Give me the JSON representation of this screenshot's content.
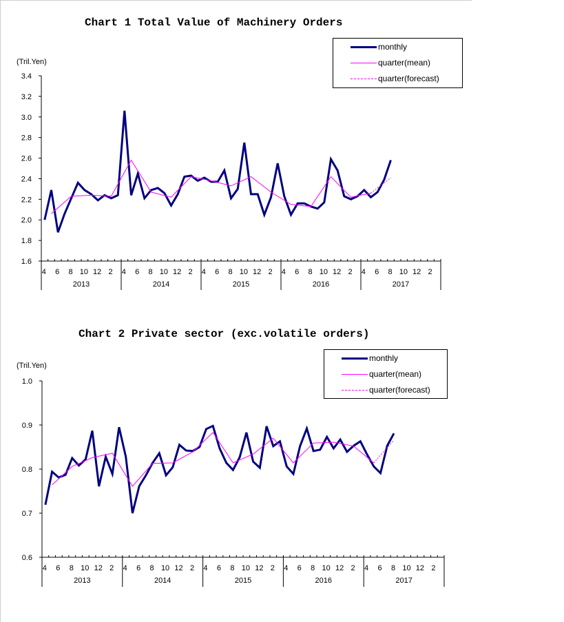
{
  "page": {
    "frame": "light-gray border top/left"
  },
  "colors": {
    "monthly": "#000080",
    "quarter_mean": "#ff00ff",
    "quarter_forecast": "#ff00ff",
    "axis": "#000000"
  },
  "legend_labels": {
    "monthly": "monthly",
    "quarter_mean": "quarter(mean)",
    "quarter_forecast": "quarter(forecast)"
  },
  "chart_data": [
    {
      "type": "line",
      "title": "Chart 1 Total Value of Machinery Orders",
      "ylabel": "(Tril.Yen)",
      "xlabel": "",
      "ylim": [
        1.6,
        3.4
      ],
      "yticks": [
        "1.6",
        "1.8",
        "2.0",
        "2.2",
        "2.4",
        "2.6",
        "2.8",
        "3.0",
        "3.2",
        "3.4"
      ],
      "ytick_values": [
        1.6,
        1.8,
        2.0,
        2.2,
        2.4,
        2.6,
        2.8,
        3.0,
        3.2,
        3.4
      ],
      "x_months": 60,
      "x_month_labels": [
        "4",
        "6",
        "8",
        "10",
        "12",
        "2"
      ],
      "x_years": [
        "2013",
        "2014",
        "2015",
        "2016",
        "2017"
      ],
      "x_start": "2013-04",
      "legend": [
        "monthly",
        "quarter(mean)",
        "quarter(forecast)"
      ],
      "legend_position": "top-right",
      "grid": false,
      "series": [
        {
          "name": "monthly",
          "start_index": 0,
          "values": [
            2.0,
            2.29,
            1.88,
            2.06,
            2.21,
            2.36,
            2.29,
            2.25,
            2.19,
            2.24,
            2.21,
            2.24,
            3.06,
            2.24,
            2.45,
            2.21,
            2.29,
            2.31,
            2.26,
            2.14,
            2.25,
            2.42,
            2.43,
            2.38,
            2.41,
            2.37,
            2.37,
            2.48,
            2.21,
            2.3,
            2.75,
            2.25,
            2.25,
            2.05,
            2.22,
            2.55,
            2.23,
            2.05,
            2.16,
            2.16,
            2.13,
            2.11,
            2.17,
            2.59,
            2.48,
            2.23,
            2.2,
            2.23,
            2.29,
            2.22,
            2.27,
            2.39,
            2.58
          ]
        },
        {
          "name": "quarter(mean)",
          "start_index": 1,
          "step": 3,
          "values": [
            2.06,
            2.23,
            2.24,
            2.23,
            2.58,
            2.27,
            2.22,
            2.42,
            2.38,
            2.33,
            2.42,
            2.27,
            2.15,
            2.13,
            2.42,
            2.22,
            2.26
          ]
        },
        {
          "name": "quarter(forecast)",
          "start_index": 49,
          "step": 3,
          "values": [
            2.26,
            2.41
          ]
        }
      ]
    },
    {
      "type": "line",
      "title": "Chart 2 Private sector (exc.volatile orders)",
      "ylabel": "(Tril.Yen)",
      "xlabel": "",
      "ylim": [
        0.6,
        1.0
      ],
      "yticks": [
        "0.6",
        "0.7",
        "0.8",
        "0.9",
        "1.0"
      ],
      "ytick_values": [
        0.6,
        0.7,
        0.8,
        0.9,
        1.0
      ],
      "x_months": 60,
      "x_month_labels": [
        "4",
        "6",
        "8",
        "10",
        "12",
        "2"
      ],
      "x_years": [
        "2013",
        "2014",
        "2015",
        "2016",
        "2017"
      ],
      "x_start": "2013-04",
      "legend": [
        "monthly",
        "quarter(mean)",
        "quarter(forecast)"
      ],
      "legend_position": "top-right",
      "grid": false,
      "series": [
        {
          "name": "monthly",
          "start_index": 0,
          "values": [
            0.719,
            0.794,
            0.781,
            0.787,
            0.825,
            0.808,
            0.822,
            0.887,
            0.761,
            0.828,
            0.789,
            0.895,
            0.828,
            0.7,
            0.761,
            0.786,
            0.814,
            0.836,
            0.786,
            0.804,
            0.855,
            0.842,
            0.841,
            0.85,
            0.891,
            0.898,
            0.847,
            0.814,
            0.798,
            0.827,
            0.883,
            0.817,
            0.803,
            0.897,
            0.852,
            0.863,
            0.806,
            0.789,
            0.852,
            0.892,
            0.841,
            0.844,
            0.873,
            0.847,
            0.867,
            0.839,
            0.853,
            0.863,
            0.833,
            0.806,
            0.791,
            0.853,
            0.881
          ]
        },
        {
          "name": "quarter(mean)",
          "start_index": 1,
          "step": 3,
          "values": [
            0.764,
            0.806,
            0.826,
            0.836,
            0.761,
            0.813,
            0.814,
            0.839,
            0.883,
            0.814,
            0.834,
            0.87,
            0.814,
            0.859,
            0.861,
            0.852,
            0.814
          ]
        },
        {
          "name": "quarter(forecast)",
          "start_index": 49,
          "step": 3,
          "values": [
            0.814,
            0.866
          ]
        }
      ]
    }
  ]
}
